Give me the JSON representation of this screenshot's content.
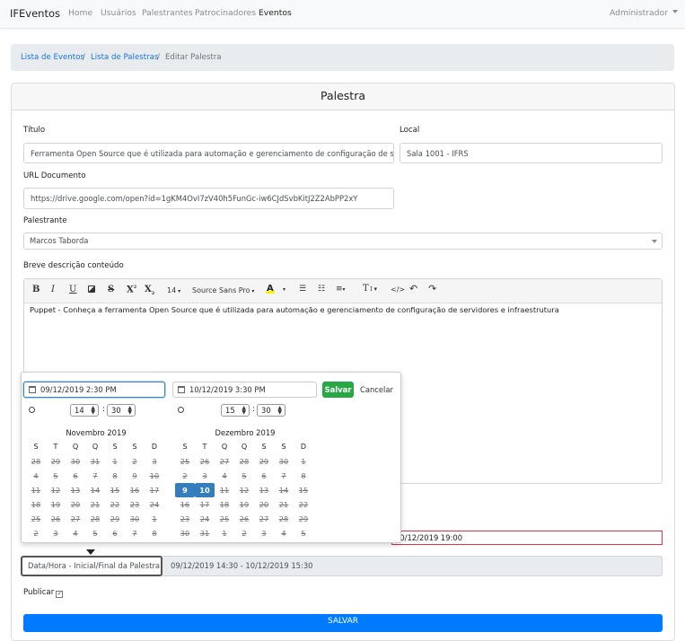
{
  "navbar": {
    "brand": "IFEventos",
    "links": [
      "Home",
      "Usuários",
      "Palestrantes",
      "Patrocinadores",
      "Eventos"
    ],
    "active": "Eventos",
    "user": "Administrador"
  },
  "breadcrumb": {
    "items": [
      "Lista de Eventos",
      "Lista de Palestras"
    ],
    "current": "Editar Palestra",
    "separator": "/"
  },
  "card": {
    "title": "Palestra"
  },
  "form": {
    "titulo_label": "Título",
    "titulo_value": "Ferramenta Open Source que é utilizada para automação e gerenciamento de configuração de servi",
    "local_label": "Local",
    "local_value": "Sala 1001 - IFRS",
    "url_label": "URL Documento",
    "url_value": "https://drive.google.com/open?id=1gKM4OvI7zV40h5FunGc-iw6CJdSvbKitJ2Z2AbPP2xY",
    "palestrante_label": "Palestrante",
    "palestrante_value": "Marcos Taborda",
    "descricao_label": "Breve descrição conteúdo",
    "descricao_value": "Puppet - Conheça a ferramenta Open Source que é utilizada para automação e gerenciamento de configuração de servidores e infraestrutura",
    "hidden_end_value": "10/12/2019 19:00",
    "datahora_label": "Data/Hora - Inicial/Final da Palestra",
    "datahora_value": "09/12/2019 14:30 - 10/12/2019 15:30",
    "publicar_label": "Publicar",
    "submit_label": "SALVAR"
  },
  "toolbar": {
    "font_size": "14",
    "font_name": "Source Sans Pro",
    "bold": "B",
    "italic": "I",
    "underline": "U",
    "strike": "S",
    "superscript": "X",
    "subscript": "X",
    "highlight": "A",
    "height": "T",
    "code": "</>"
  },
  "picker": {
    "start_input": "09/12/2019 2:30 PM",
    "end_input": "10/12/2019 3:30 PM",
    "apply_label": "Salvar",
    "cancel_label": "Cancelar",
    "left_time": {
      "hour": "14",
      "minute": "30"
    },
    "right_time": {
      "hour": "15",
      "minute": "30"
    },
    "dow": [
      "S",
      "T",
      "Q",
      "Q",
      "S",
      "S",
      "D"
    ],
    "left_month": {
      "title": "Novembro 2019",
      "rows": [
        [
          "28",
          "29",
          "30",
          "31",
          "1",
          "2",
          "3"
        ],
        [
          "4",
          "5",
          "6",
          "7",
          "8",
          "9",
          "10"
        ],
        [
          "11",
          "12",
          "13",
          "14",
          "15",
          "16",
          "17"
        ],
        [
          "18",
          "19",
          "20",
          "21",
          "22",
          "23",
          "24"
        ],
        [
          "25",
          "26",
          "27",
          "28",
          "29",
          "30",
          "1"
        ],
        [
          "2",
          "3",
          "4",
          "5",
          "6",
          "7",
          "8"
        ]
      ]
    },
    "right_month": {
      "title": "Dezembro 2019",
      "rows": [
        [
          "25",
          "26",
          "27",
          "28",
          "29",
          "30",
          "1"
        ],
        [
          "2",
          "3",
          "4",
          "5",
          "6",
          "7",
          "8"
        ],
        [
          "9",
          "10",
          "11",
          "12",
          "13",
          "14",
          "15"
        ],
        [
          "16",
          "17",
          "18",
          "19",
          "20",
          "21",
          "22"
        ],
        [
          "23",
          "24",
          "25",
          "26",
          "27",
          "28",
          "29"
        ],
        [
          "30",
          "31",
          "1",
          "2",
          "3",
          "4",
          "5"
        ]
      ],
      "selected_start": "9",
      "selected_end": "10"
    }
  },
  "colors": {
    "primary": "#007bff",
    "success": "#28a745",
    "danger": "#dc3545",
    "range": "#357ebd"
  }
}
